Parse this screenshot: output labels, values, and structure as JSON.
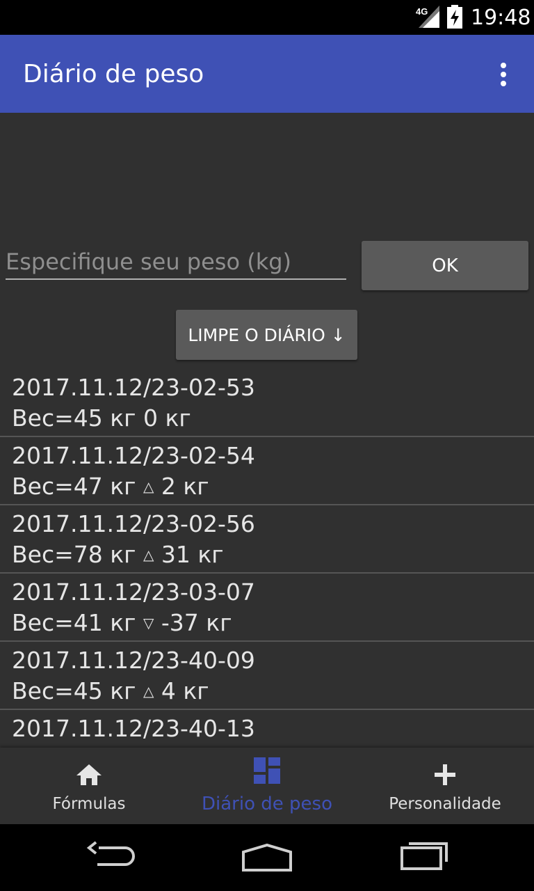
{
  "status_bar": {
    "network_type": "4G",
    "time": "19:48",
    "icons": [
      "signal-icon",
      "battery-charging-icon"
    ]
  },
  "app_bar": {
    "title": "Diário de peso",
    "menu_icon": "overflow-menu-icon",
    "color": "#3f51b5"
  },
  "weight_form": {
    "input_placeholder": "Especifique seu peso (kg)",
    "input_value": "",
    "ok_label": "OK",
    "clear_label": "LIMPE O DIÁRIO ↓"
  },
  "log": {
    "entries": [
      {
        "date": "2017.11.12/23-02-53",
        "weight_text": "Вес=45 кг",
        "change_arrow": "",
        "change_text": "0 кг"
      },
      {
        "date": "2017.11.12/23-02-54",
        "weight_text": "Вес=47 кг",
        "change_arrow": "△",
        "change_text": "2 кг"
      },
      {
        "date": "2017.11.12/23-02-56",
        "weight_text": "Вес=78 кг",
        "change_arrow": "△",
        "change_text": "31 кг"
      },
      {
        "date": "2017.11.12/23-03-07",
        "weight_text": "Вес=41 кг",
        "change_arrow": "▽",
        "change_text": "-37 кг"
      },
      {
        "date": "2017.11.12/23-40-09",
        "weight_text": "Вес=45 кг",
        "change_arrow": "△",
        "change_text": "4 кг"
      },
      {
        "date": "2017.11.12/23-40-13",
        "weight_text": "",
        "change_arrow": "",
        "change_text": ""
      }
    ]
  },
  "bottom_nav": {
    "items": [
      {
        "label": "Fórmulas",
        "icon": "home-icon",
        "active": false
      },
      {
        "label": "Diário de peso",
        "icon": "dashboard-icon",
        "active": true
      },
      {
        "label": "Personalidade",
        "icon": "plus-icon",
        "active": false
      }
    ],
    "active_color": "#3f51b5"
  },
  "system_nav": {
    "icons": [
      "back-icon",
      "home-button-icon",
      "recent-apps-icon"
    ]
  }
}
